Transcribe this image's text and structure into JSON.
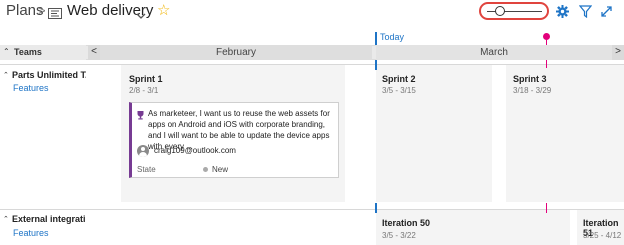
{
  "header": {
    "breadcrumb_root": "Plans",
    "breadcrumb_sep": ">",
    "plan_title": "Web delivery"
  },
  "timeline": {
    "today_label": "Today",
    "teams_header": "Teams",
    "nav_left": "<",
    "nav_right": ">",
    "months": [
      "February",
      "March"
    ]
  },
  "teams": [
    {
      "name": "Parts Unlimited T...",
      "link": "Features",
      "sprints": [
        {
          "name": "Sprint 1",
          "dates": "2/8 - 3/1"
        },
        {
          "name": "Sprint 2",
          "dates": "3/5 - 3/15"
        },
        {
          "name": "Sprint 3",
          "dates": "3/18 - 3/29"
        }
      ],
      "card": {
        "text": "As marketeer, I want us to reuse the web assets for apps on Android and iOS with corporate branding, and I will want to be able to update the device apps with every ...",
        "assigned_to": "craig109@outlook.com",
        "state_label": "State",
        "state_value": "New"
      }
    },
    {
      "name": "External integrati...",
      "link": "Features",
      "sprints": [
        {
          "name": "Iteration 50",
          "dates": "3/5 - 3/22"
        },
        {
          "name": "Iteration 51",
          "dates": "3/25 - 4/12"
        }
      ]
    }
  ],
  "colors": {
    "accent": "#1e74c6",
    "today_marker": "#1e74c6",
    "milestone_marker": "#e3007b",
    "card_border": "#773b93",
    "zoom_highlight": "#e0443e"
  },
  "icons": {
    "plan": "plan-board-icon",
    "favorite": "star-icon",
    "settings": "gear-icon",
    "filter": "filter-icon",
    "fullscreen": "expand-icon"
  }
}
